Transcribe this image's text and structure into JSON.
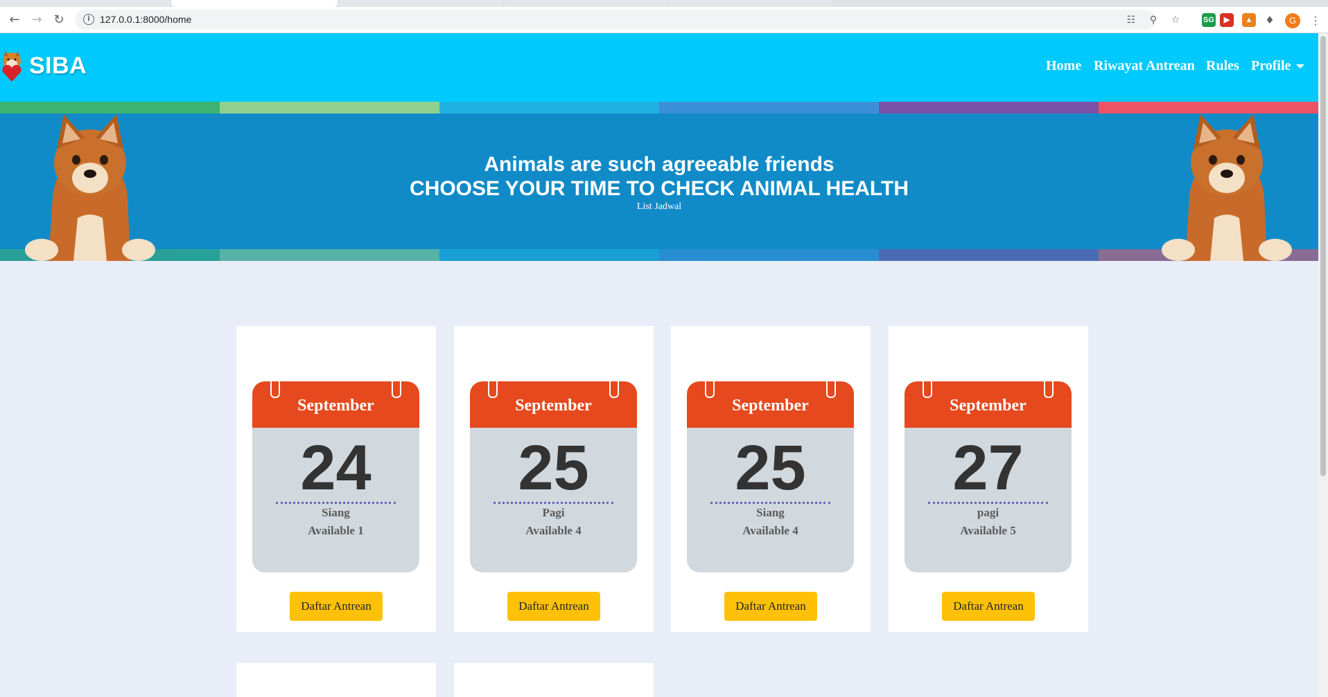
{
  "browser": {
    "url": "127.0.0.1:8000/home"
  },
  "navbar": {
    "brand": "SIBA",
    "links": {
      "home": "Home",
      "history": "Riwayat Antrean",
      "rules": "Rules",
      "profile": "Profile"
    },
    "background_color": "#00cafd"
  },
  "hero": {
    "line1": "Animals are such agreeable friends",
    "line2": "CHOOSE YOUR TIME TO CHECK ANIMAL HEALTH",
    "subtitle": "List Jadwal",
    "background_color": "#118bc8"
  },
  "schedule": [
    {
      "month": "September",
      "day": "24",
      "session": "Siang",
      "available": "Available 1",
      "button": "Daftar Antrean"
    },
    {
      "month": "September",
      "day": "25",
      "session": "Pagi",
      "available": "Available 4",
      "button": "Daftar Antrean"
    },
    {
      "month": "September",
      "day": "25",
      "session": "Siang",
      "available": "Available 4",
      "button": "Daftar Antrean"
    },
    {
      "month": "September",
      "day": "27",
      "session": "pagi",
      "available": "Available 5",
      "button": "Daftar Antrean"
    }
  ],
  "colors": {
    "calendar_header": "#e5491d",
    "calendar_body": "#d1d8de",
    "button": "#ffc107",
    "page_background": "#e8edf8"
  }
}
